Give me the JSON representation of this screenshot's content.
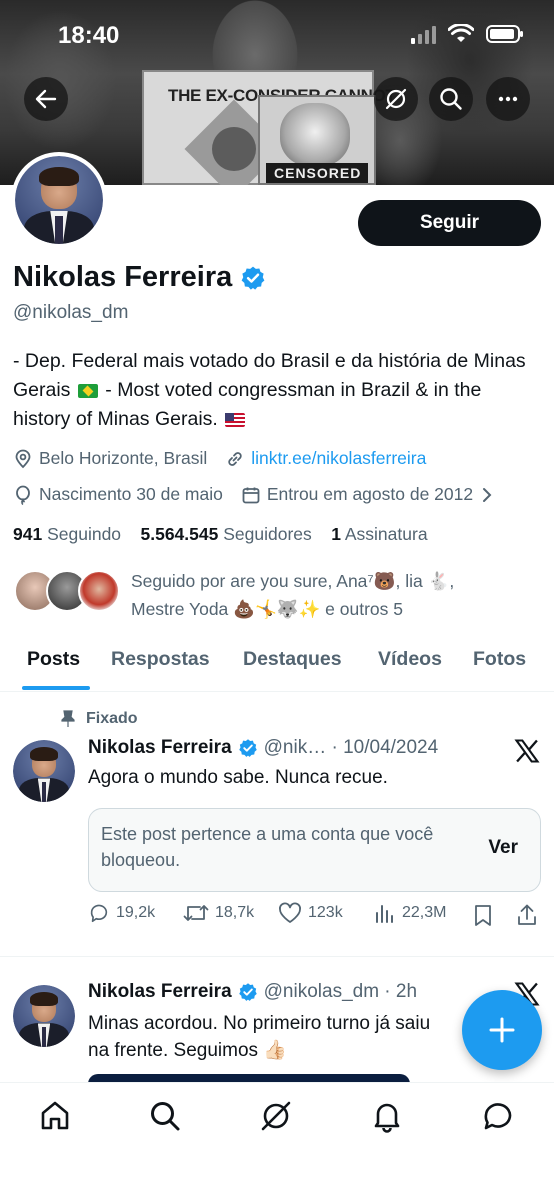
{
  "status_bar": {
    "time": "18:40"
  },
  "banner": {
    "sign_text": "THE EX-CONSIDER CANNOT",
    "sign_censored": "CENSORED"
  },
  "profile": {
    "name": "Nikolas Ferreira",
    "verified": true,
    "handle": "@nikolas_dm",
    "follow_label": "Seguir",
    "bio": {
      "part1": "- Dep. Federal mais votado do Brasil e da história de Minas Gerais",
      "part2": "- Most voted congressman in Brazil & in the history of Minas Gerais."
    },
    "location": "Belo Horizonte, Brasil",
    "website": "linktr.ee/nikolasferreira",
    "birthday": "Nascimento 30 de maio",
    "joined": "Entrou em agosto de 2012",
    "stats": {
      "following_count": "941",
      "following_label": "Seguindo",
      "followers_count": "5.564.545",
      "followers_label": "Seguidores",
      "subs_count": "1",
      "subs_label": "Assinatura"
    },
    "followed_by_line1": "Seguido por are you sure, Ana⁷🐻, lia 🐇,",
    "followed_by_line2": "Mestre Yoda 💩🤸🐺✨ e outros 5"
  },
  "tabs": [
    "Posts",
    "Respostas",
    "Destaques",
    "Vídeos",
    "Fotos"
  ],
  "posts": [
    {
      "pinned_label": "Fixado",
      "name": "Nikolas Ferreira",
      "meta": "@nik… · 10/04/2024",
      "text": "Agora o mundo sabe. Nunca recue.",
      "blocked_text": "Este post pertence a uma conta que você bloqueou.",
      "blocked_action": "Ver",
      "replies": "19,2k",
      "reposts": "18,7k",
      "likes": "123k",
      "views": "22,3M"
    },
    {
      "name": "Nikolas Ferreira",
      "meta": "@nikolas_dm · 2h",
      "text_line1": "Minas acordou. No primeiro turno já saiu",
      "text_line2": "na frente. Seguimos 👍🏻"
    }
  ],
  "colors": {
    "accent": "#1d9bf0",
    "text": "#0f1419",
    "secondary": "#536471"
  },
  "icons": {
    "header": [
      "back-arrow-icon",
      "grok-icon",
      "search-icon",
      "more-icon"
    ],
    "bottom_nav": [
      "home-icon",
      "search-icon",
      "grok-icon",
      "notifications-icon",
      "messages-icon"
    ]
  }
}
